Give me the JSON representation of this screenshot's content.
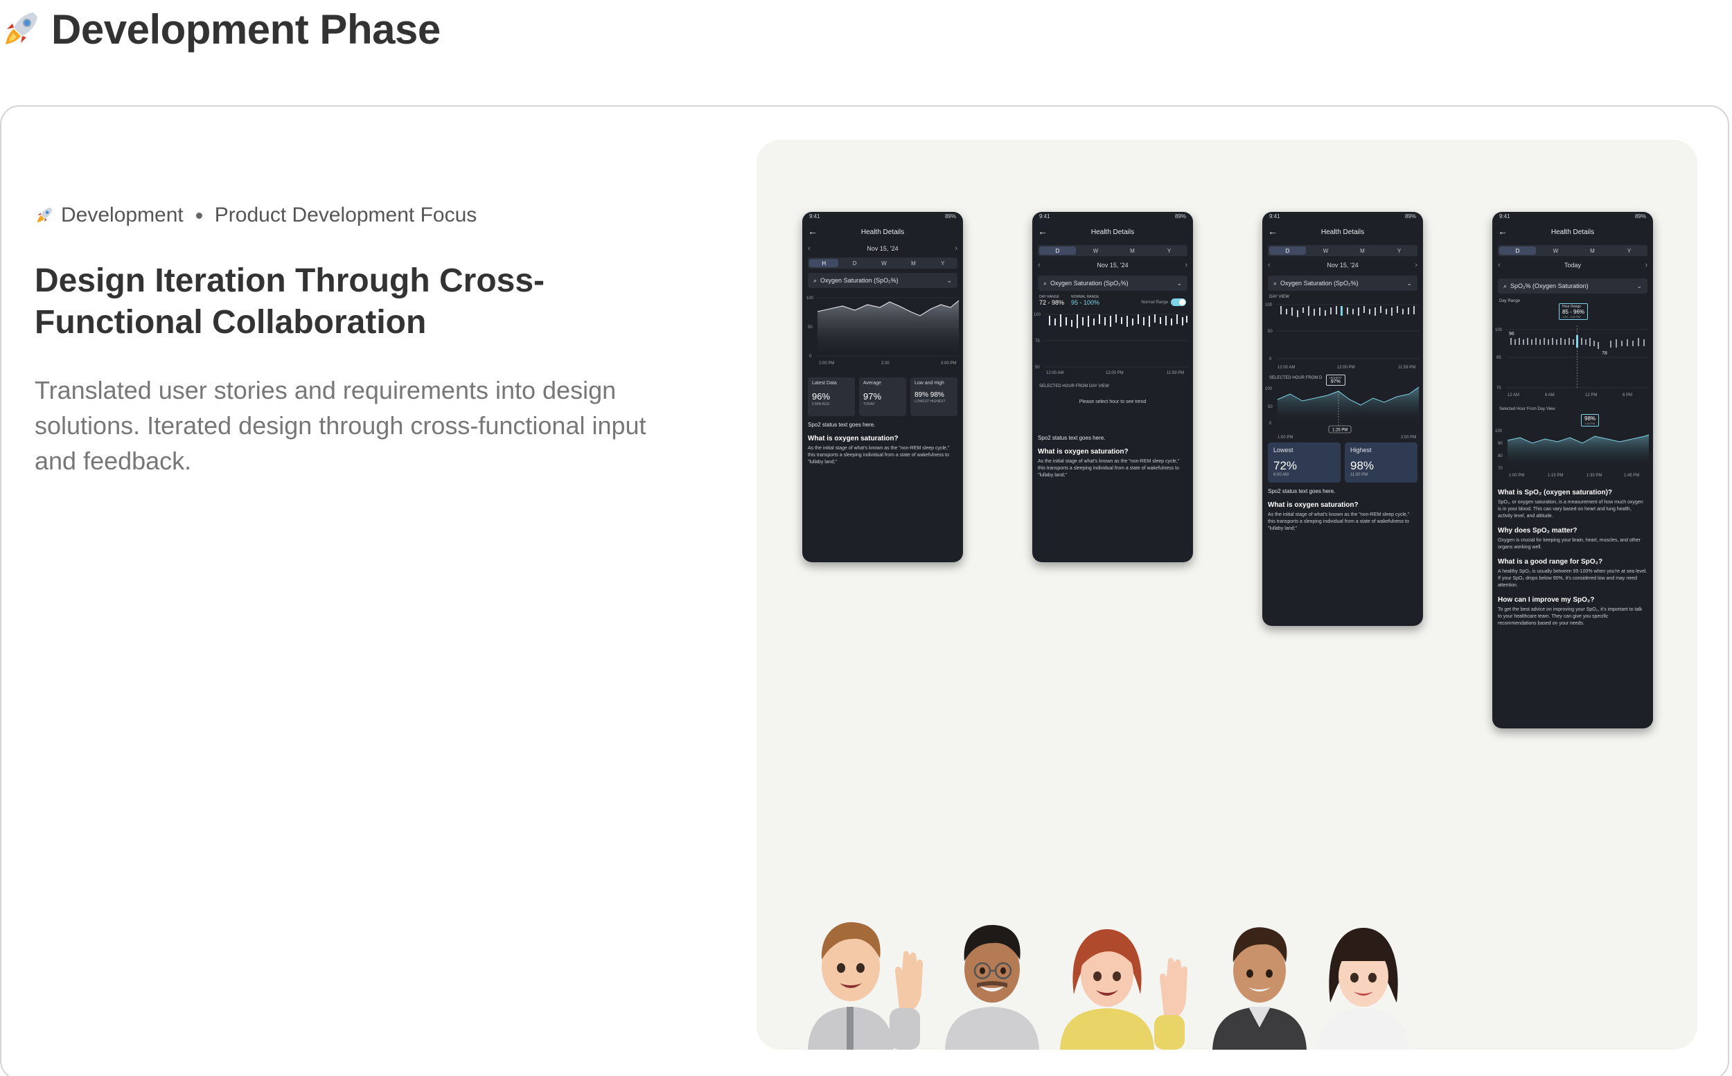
{
  "page": {
    "title": "Development Phase",
    "header_icon": "rocket-icon"
  },
  "section": {
    "category": "Development",
    "focus": "Product Development Focus",
    "headline": "Design Iteration Through Cross-Functional Collaboration",
    "description": "Translated user stories and requirements into design solutions. Iterated design through cross-functional input and feedback."
  },
  "phones": [
    {
      "status_time": "9:41",
      "status_battery": "89%",
      "title": "Health Details",
      "date": "Nov 15, '24",
      "tabs": [
        "H",
        "D",
        "W",
        "M",
        "Y"
      ],
      "metric": "Oxygen Saturation (SpO₂%)",
      "axis_y": [
        "100",
        "50",
        "0"
      ],
      "axis_x": [
        "2:00 PM",
        "2:30",
        "3:00 PM"
      ],
      "stats": [
        {
          "title": "Latest Data",
          "value": "96%",
          "sub": "5 MIN AGO"
        },
        {
          "title": "Average",
          "value": "97%",
          "sub": "TODAY"
        },
        {
          "title": "Low and High",
          "value": "89%  98%",
          "sub": "LOWEST   HIGHEST"
        }
      ],
      "status_text": "Spo2 status text goes here.",
      "question": "What is oxygen saturation?",
      "answer": "As the initial stage of what's known as the \"non-REM sleep cycle,\" this transports a sleeping individual from a state of wakefulness to \"lullaby land;\""
    },
    {
      "status_time": "9:41",
      "status_battery": "89%",
      "title": "Health Details",
      "date": "Nov 15, '24",
      "tabs": [
        "D",
        "W",
        "M",
        "Y"
      ],
      "metric": "Oxygen Saturation (SpO₂%)",
      "day_range_label": "DAY RANGE",
      "day_range": "72 - 98%",
      "normal_range_label": "NORMAL RANGE",
      "normal_range": "95 - 100%",
      "toggle_label": "Normal Range",
      "axis_y": [
        "100",
        "75",
        "50"
      ],
      "axis_x": [
        "12:00 AM",
        "12:00 PM",
        "11:59 PM"
      ],
      "selected_label": "SELECTED HOUR FROM DAY VIEW",
      "hint": "Please select hour to see trend",
      "status_text": "Spo2 status text goes here.",
      "question": "What is oxygen saturation?",
      "answer": "As the initial stage of what's known as the \"non-REM sleep cycle,\" this transports a sleeping individual from a state of wakefulness to \"lullaby land;\""
    },
    {
      "status_time": "9:41",
      "status_battery": "89%",
      "title": "Health Details",
      "date": "Nov 15, '24",
      "tabs": [
        "D",
        "W",
        "M",
        "Y"
      ],
      "metric": "Oxygen Saturation (SpO₂%)",
      "day_view_label": "DAY VIEW",
      "axis_y": [
        "100",
        "50",
        "0"
      ],
      "axis_x": [
        "12:00 AM",
        "12:00 PM",
        "11:59 PM"
      ],
      "selected_label": "SELECTED HOUR FROM D",
      "tooltip_label": "HIGHEST",
      "tooltip_value": "97%",
      "time_marker": "1:25 PM",
      "axis_x2": [
        "1:00 PM",
        "2:00 PM"
      ],
      "lowest_label": "Lowest",
      "lowest_value": "72%",
      "lowest_time": "6:00 AM",
      "highest_label": "Highest",
      "highest_value": "98%",
      "highest_time": "11:00 PM",
      "status_text": "Spo2 status text goes here.",
      "question": "What is oxygen saturation?",
      "answer": "As the initial stage of what's known as the \"non-REM sleep cycle,\" this transports a sleeping individual from a state of wakefulness to \"lullaby land;\""
    },
    {
      "status_time": "9:41",
      "status_battery": "89%",
      "title": "Health Details",
      "date": "Today",
      "tabs": [
        "D",
        "W",
        "M",
        "Y"
      ],
      "metric": "SpO₂% (Oxygen Saturation)",
      "day_range_label": "Day Range",
      "tooltip_label": "Hour Range",
      "tooltip_value": "85 - 96%",
      "tooltip_time": "1:00 - 2:00 PM",
      "axis_y": [
        "100",
        "85",
        "70"
      ],
      "marker_96": "96",
      "marker_78": "78",
      "axis_x": [
        "12 AM",
        "6 AM",
        "12 PM",
        "6 PM"
      ],
      "selected_label": "Selected Hour From Day View",
      "tooltip2_value": "98%",
      "tooltip2_time": "1:40 PM",
      "axis_y2": [
        "100",
        "90",
        "80",
        "70"
      ],
      "axis_x2": [
        "1:00 PM",
        "1:15 PM",
        "1:30 PM",
        "1:45 PM"
      ],
      "faq": [
        {
          "q": "What is SpO₂ (oxygen saturation)?",
          "a": "SpO₂, or oxygen saturation, is a measurement of how much oxygen is in your blood. This can vary based on heart and lung health, activity level, and altitude."
        },
        {
          "q": "Why does SpO₂ matter?",
          "a": "Oxygen is crucial for keeping your brain, heart, muscles, and other organs working well."
        },
        {
          "q": "What is a good range for SpO₂?",
          "a": "A healthy SpO₂ is usually between 95-100% when you're at sea level. If your SpO₂ drops below 90%, it's considered low and may need attention."
        },
        {
          "q": "How can I improve my SpO₂?",
          "a": "To get the best advice on improving your SpO₂, it's important to talk to your healthcare team. They can give you specific recommendations based on your needs."
        }
      ]
    }
  ],
  "team": [
    "team-avatar-1",
    "team-avatar-2",
    "team-avatar-3",
    "team-avatar-4",
    "team-avatar-5"
  ]
}
